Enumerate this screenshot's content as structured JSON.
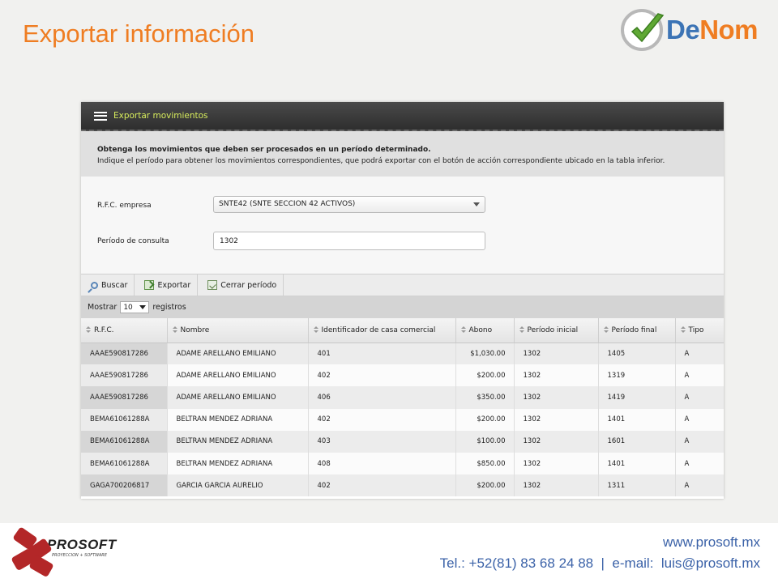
{
  "slide": {
    "title": "Exportar información",
    "brand_de": "De",
    "brand_nom": "Nom"
  },
  "app": {
    "window_title": "Exportar movimientos",
    "info_strong": "Obtenga los movimientos que deben ser procesados en un período determinado.",
    "info_text": "Indique el período para obtener los movimientos correspondientes, que podrá exportar con el botón de acción correspondiente ubicado en la tabla inferior.",
    "form": {
      "rfc_label": "R.F.C. empresa",
      "rfc_value": "SNTE42 (SNTE SECCION 42 ACTIVOS)",
      "periodo_label": "Período de consulta",
      "periodo_value": "1302"
    },
    "toolbar": {
      "buscar": "Buscar",
      "exportar": "Exportar",
      "cerrar": "Cerrar período"
    },
    "length": {
      "prefix": "Mostrar",
      "value": "10",
      "suffix": "registros"
    },
    "table": {
      "headers": [
        "R.F.C.",
        "Nombre",
        "Identificador de casa comercial",
        "Abono",
        "Período inicial",
        "Período final",
        "Tipo"
      ],
      "rows": [
        [
          "AAAE590817286",
          "ADAME ARELLANO EMILIANO",
          "401",
          "$1,030.00",
          "1302",
          "1405",
          "A"
        ],
        [
          "AAAE590817286",
          "ADAME ARELLANO EMILIANO",
          "402",
          "$200.00",
          "1302",
          "1319",
          "A"
        ],
        [
          "AAAE590817286",
          "ADAME ARELLANO EMILIANO",
          "406",
          "$350.00",
          "1302",
          "1419",
          "A"
        ],
        [
          "BEMA61061288A",
          "BELTRAN MENDEZ ADRIANA",
          "402",
          "$200.00",
          "1302",
          "1401",
          "A"
        ],
        [
          "BEMA61061288A",
          "BELTRAN MENDEZ ADRIANA",
          "403",
          "$100.00",
          "1302",
          "1601",
          "A"
        ],
        [
          "BEMA61061288A",
          "BELTRAN MENDEZ ADRIANA",
          "408",
          "$850.00",
          "1302",
          "1401",
          "A"
        ],
        [
          "GAGA700206817",
          "GARCIA GARCIA AURELIO",
          "402",
          "$200.00",
          "1302",
          "1311",
          "A"
        ]
      ]
    }
  },
  "footer": {
    "logo_name": "PROSOFT",
    "logo_sub": "PROYECCION + SOFTWARE",
    "web": "www.prosoft.mx",
    "contact": "Tel.: +52(81) 83 68 24 88  |  e-mail:  luis@prosoft.mx"
  },
  "colors": {
    "title_orange": "#ef7d22",
    "brand_blue": "#3c74b5",
    "footer_blue": "#3b62a8",
    "titlebar_text": "#d7ec5c"
  },
  "icons": [
    "check-logo-icon",
    "menu-icon",
    "search-icon",
    "export-icon",
    "close-period-icon",
    "sort-icon",
    "dropdown-caret-icon"
  ]
}
